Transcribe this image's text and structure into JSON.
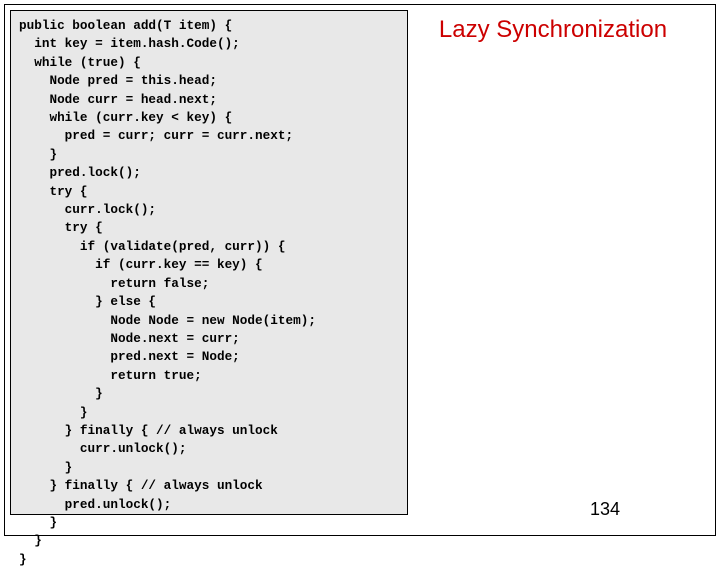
{
  "title": "Lazy Synchronization",
  "page_number": "134",
  "code_lines": [
    "public boolean add(T item) {",
    "  int key = item.hash.Code();",
    "  while (true) {",
    "    Node pred = this.head;",
    "    Node curr = head.next;",
    "    while (curr.key < key) {",
    "      pred = curr; curr = curr.next;",
    "    }",
    "    pred.lock();",
    "    try {",
    "      curr.lock();",
    "      try {",
    "        if (validate(pred, curr)) {",
    "          if (curr.key == key) {",
    "            return false;",
    "          } else {",
    "            Node Node = new Node(item);",
    "            Node.next = curr;",
    "            pred.next = Node;",
    "            return true;",
    "          }",
    "        }",
    "      } finally { // always unlock",
    "        curr.unlock();",
    "      }",
    "    } finally { // always unlock",
    "      pred.unlock();",
    "    }",
    "  }",
    "}"
  ]
}
